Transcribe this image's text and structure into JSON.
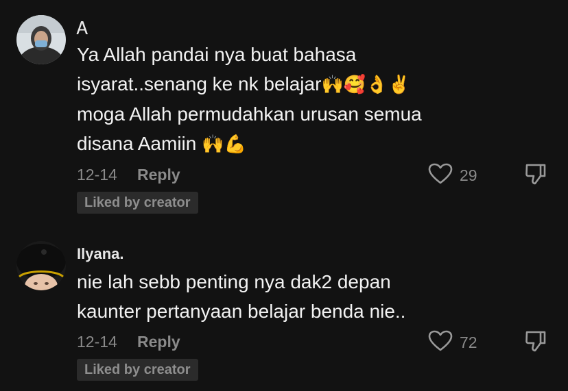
{
  "comments": [
    {
      "username": "Ꭺ",
      "lines": [
        "Ya Allah pandai nya buat bahasa",
        "isyarat..senang ke nk belajar",
        "moga Allah permudahkan urusan semua",
        "disana Aamiin"
      ],
      "line2_emoji": "🙌🥰👌✌️",
      "line4_emoji": "🙌💪",
      "date": "12-14",
      "reply_label": "Reply",
      "likes": "29",
      "badge": "Liked by creator"
    },
    {
      "username": "Ilyana.",
      "lines": [
        "nie lah sebb penting nya dak2 depan",
        "kaunter pertanyaan belajar benda nie.."
      ],
      "date": "12-14",
      "reply_label": "Reply",
      "likes": "72",
      "badge": "Liked by creator"
    }
  ],
  "colors": {
    "background": "#121212",
    "text_primary": "#f2f2f2",
    "text_secondary": "#8a8a8a",
    "badge_bg": "#2b2b2b"
  },
  "icons": {
    "like": "heart-outline-icon",
    "dislike": "thumbs-down-outline-icon"
  }
}
